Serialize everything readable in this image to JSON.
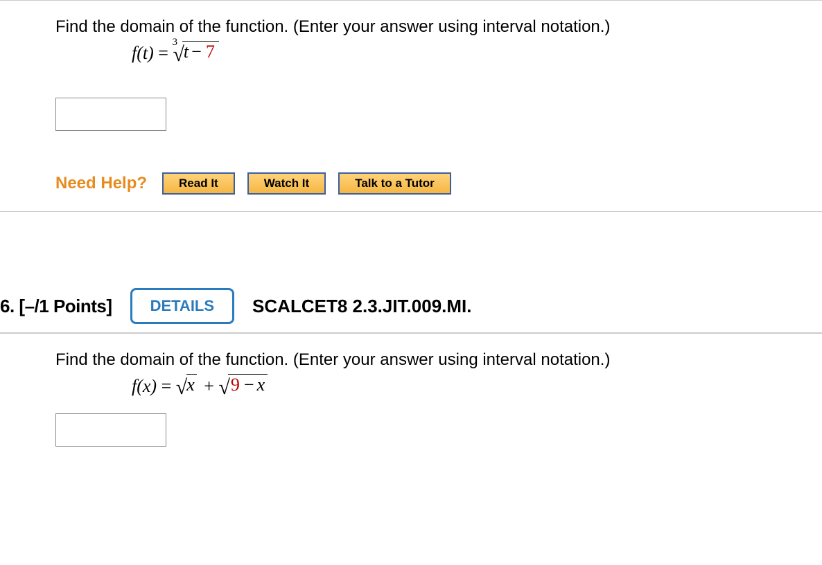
{
  "q1": {
    "prompt": "Find the domain of the function. (Enter your answer using interval notation.)",
    "func_lhs": "f(t)",
    "root_index": "3",
    "radicand_var": "t",
    "radicand_const": "7",
    "answer_value": ""
  },
  "help": {
    "label": "Need Help?",
    "read": "Read It",
    "watch": "Watch It",
    "tutor": "Talk to a Tutor"
  },
  "q2header": {
    "number": "6.",
    "points": "[–/1 Points]",
    "details": "DETAILS",
    "ref": "SCALCET8 2.3.JIT.009.MI."
  },
  "q2": {
    "prompt": "Find the domain of the function. (Enter your answer using interval notation.)",
    "func_lhs": "f(x)",
    "rad1_var": "x",
    "rad2_const": "9",
    "rad2_var": "x",
    "answer_value": ""
  }
}
